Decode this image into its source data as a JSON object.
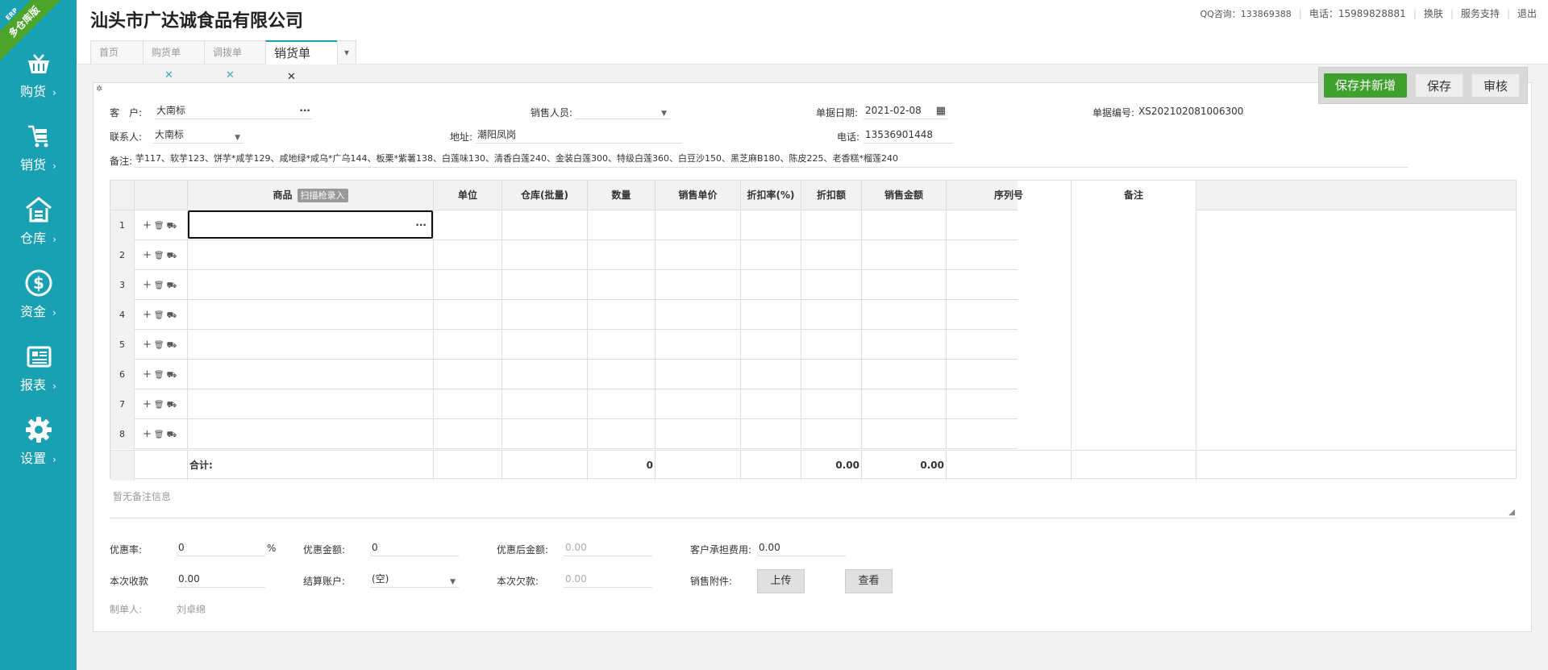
{
  "sidebar": {
    "badge": {
      "small": "ERP",
      "label": "多仓库版"
    },
    "items": [
      {
        "label": "购货",
        "icon": "basket-icon"
      },
      {
        "label": "销货",
        "icon": "cart-icon"
      },
      {
        "label": "仓库",
        "icon": "warehouse-icon"
      },
      {
        "label": "资金",
        "icon": "dollar-icon"
      },
      {
        "label": "报表",
        "icon": "report-icon"
      },
      {
        "label": "设置",
        "icon": "gear-icon"
      }
    ],
    "chevron": "›"
  },
  "header": {
    "company": "汕头市广达诚食品有限公司",
    "links": {
      "qq": "QQ咨询：133869388",
      "phone": "电话：15989828881",
      "skin": "换肤",
      "support": "服务支持",
      "logout": "退出"
    },
    "tabs": [
      {
        "label": "首页",
        "closable": false
      },
      {
        "label": "购货单",
        "closable": true
      },
      {
        "label": "调拨单",
        "closable": true
      },
      {
        "label": "销货单",
        "closable": true,
        "active": true
      }
    ],
    "tab_close": "✕"
  },
  "actions": {
    "save_new": "保存并新增",
    "save": "保存",
    "audit": "审核"
  },
  "form": {
    "customer_label": "客　户:",
    "customer_value": "大南标",
    "customer_more": "···",
    "salesman_label": "销售人员:",
    "salesman_value": "",
    "date_label": "单据日期:",
    "date_value": "2021-02-08",
    "billno_label": "单据编号:",
    "billno_value": "XS202102081006300",
    "contact_label": "联系人:",
    "contact_value": "大南标",
    "address_label": "地址:",
    "address_value": "潮阳凤岗",
    "phone_label": "电话:",
    "phone_value": "13536901448",
    "remark_label": "备注:",
    "remark_value": "芋117、软芋123、饼芋*咸芋129、咸地绿*咸乌*广乌144、板栗*紫薯138、白莲味130、清香白莲240、金装白莲300、特级白莲360、白豆沙150、黑芝麻B180、陈皮225、老香糕*榴莲240"
  },
  "grid": {
    "headers": {
      "product": "商品",
      "scan": "扫描枪录入",
      "unit": "单位",
      "warehouse": "仓库(批量)",
      "qty": "数量",
      "price": "销售单价",
      "discount_rate": "折扣率(%)",
      "discount_amt": "折扣额",
      "amount": "销售金额",
      "serial": "序列号",
      "note": "备注"
    },
    "rows": [
      "1",
      "2",
      "3",
      "4",
      "5",
      "6",
      "7",
      "8"
    ],
    "row_ops": "+ 🗑 ⛟",
    "active_more": "···",
    "total_label": "合计:",
    "total_qty": "0",
    "total_discount": "0.00",
    "total_amount": "0.00"
  },
  "memo": {
    "placeholder": "暂无备注信息"
  },
  "footer": {
    "discount_rate_label": "优惠率:",
    "discount_rate_value": "0",
    "percent": "%",
    "discount_amt_label": "优惠金额:",
    "discount_amt_value": "0",
    "after_discount_label": "优惠后金额:",
    "after_discount_value": "0.00",
    "customer_fee_label": "客户承担费用:",
    "customer_fee_value": "0.00",
    "received_label": "本次收款",
    "received_value": "0.00",
    "account_label": "结算账户:",
    "account_value": "(空)",
    "debt_label": "本次欠款:",
    "debt_value": "0.00",
    "attach_label": "销售附件:",
    "upload": "上传",
    "view": "查看",
    "maker_label": "制单人:",
    "maker_value": "刘卓绵"
  },
  "colors": {
    "sidebar": "#1aa0b3",
    "primary_button": "#3fa02e",
    "ribbon": "#4ca42a"
  }
}
